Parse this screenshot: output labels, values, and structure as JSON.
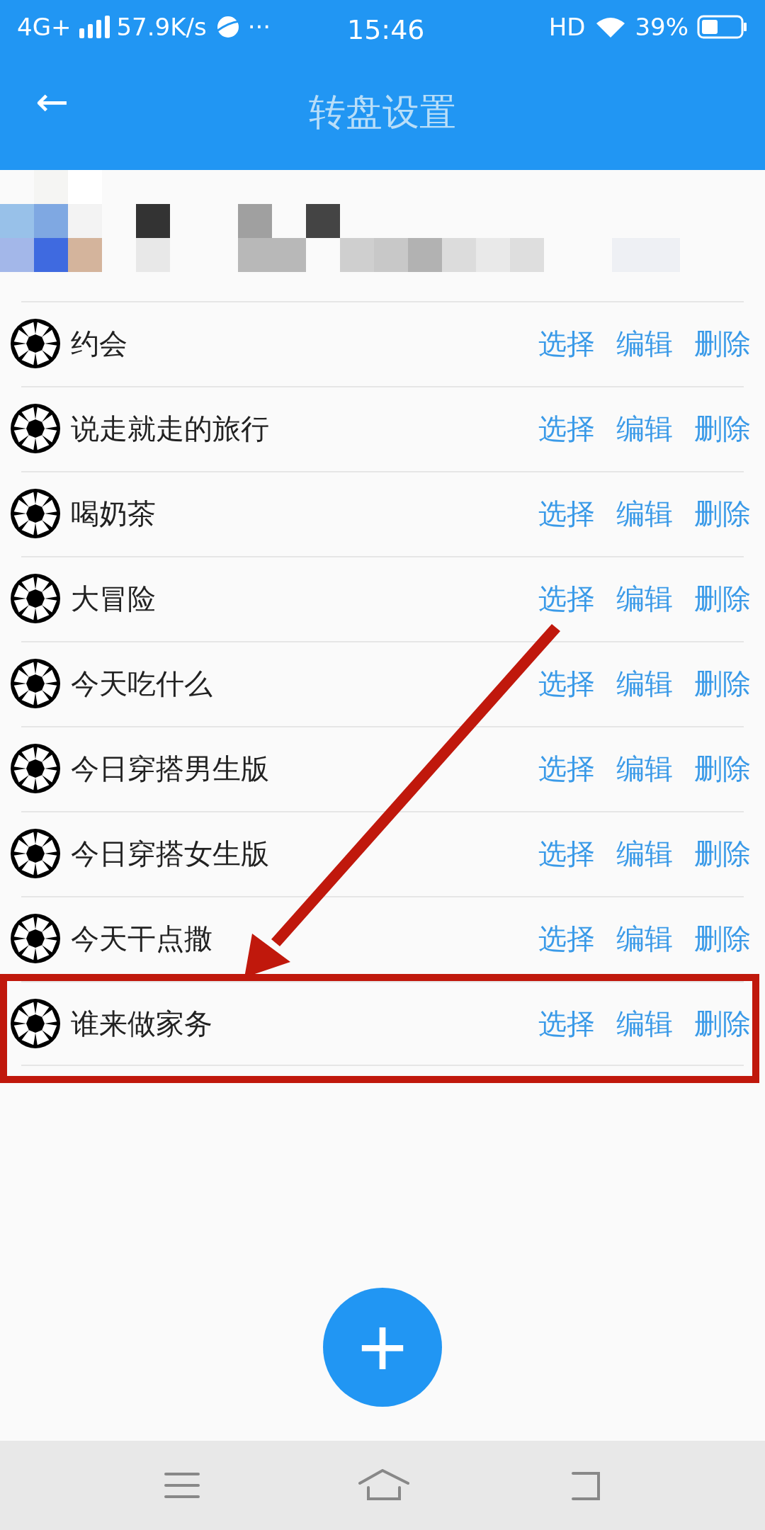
{
  "status_bar": {
    "network": "4G+",
    "speed": "57.9K/s",
    "more": "···",
    "time": "15:46",
    "hd": "HD",
    "battery": "39%"
  },
  "header": {
    "back": "←",
    "title": "转盘设置"
  },
  "items": [
    {
      "name": "约会",
      "actions": [
        "选择",
        "编辑",
        "删除"
      ],
      "highlighted": false
    },
    {
      "name": "说走就走的旅行",
      "actions": [
        "选择",
        "编辑",
        "删除"
      ],
      "highlighted": false
    },
    {
      "name": "喝奶茶",
      "actions": [
        "选择",
        "编辑",
        "删除"
      ],
      "highlighted": false
    },
    {
      "name": "大冒险",
      "actions": [
        "选择",
        "编辑",
        "删除"
      ],
      "highlighted": false
    },
    {
      "name": "今天吃什么",
      "actions": [
        "选择",
        "编辑",
        "删除"
      ],
      "highlighted": false
    },
    {
      "name": "今日穿搭男生版",
      "actions": [
        "选择",
        "编辑",
        "删除"
      ],
      "highlighted": false
    },
    {
      "name": "今日穿搭女生版",
      "actions": [
        "选择",
        "编辑",
        "删除"
      ],
      "highlighted": false
    },
    {
      "name": "今天干点撒",
      "actions": [
        "选择",
        "编辑",
        "删除"
      ],
      "highlighted": false
    },
    {
      "name": "谁来做家务",
      "actions": [
        "选择",
        "编辑",
        "删除"
      ],
      "highlighted": true
    }
  ],
  "fab": {
    "label": "+"
  }
}
